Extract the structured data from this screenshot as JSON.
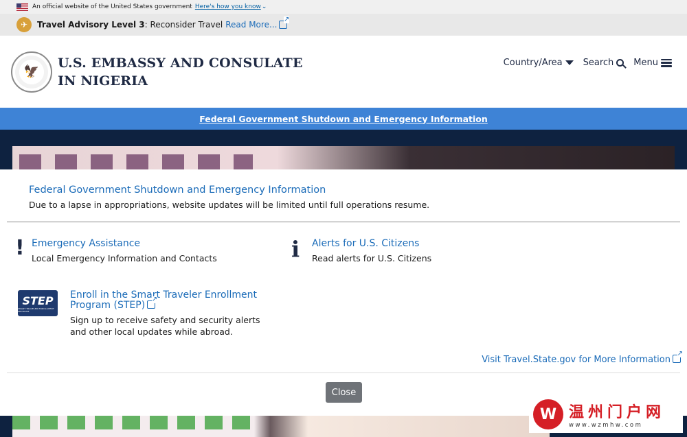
{
  "gov_banner": {
    "text": "An official website of the United States government",
    "link": "Here's how you know"
  },
  "advisory": {
    "label": "Travel Advisory Level 3",
    "separator": ": Reconsider Travel",
    "link": "Read More..."
  },
  "header": {
    "title_line1": "U.S. EMBASSY AND CONSULATE",
    "title_line2": "IN NIGERIA",
    "nav": {
      "country": "Country/Area",
      "search": "Search",
      "menu": "Menu"
    }
  },
  "shutdown_bar": {
    "link": "Federal Government Shutdown and Emergency Information"
  },
  "modal": {
    "title": "Federal Government Shutdown and Emergency Information",
    "subtitle": "Due to a lapse in appropriations, website updates will be limited until full operations resume.",
    "cards": {
      "emergency": {
        "icon": "!",
        "title": "Emergency Assistance",
        "desc": "Local Emergency Information and Contacts"
      },
      "alerts": {
        "icon": "i",
        "title": "Alerts for U.S. Citizens",
        "desc": "Read alerts for U.S. Citizens"
      },
      "step": {
        "logo": "STEP",
        "title_line1": "Enroll in the Smart Traveler Enrollment",
        "title_line2": "Program (STEP)",
        "desc_line1": "Sign up to receive safety and security alerts",
        "desc_line2": "and other local updates while abroad."
      }
    },
    "visit_link": "Visit Travel.State.gov for More Information",
    "close_label": "Close"
  },
  "watermark": {
    "name": "温州门户网",
    "url": "www.wzmhw.com"
  },
  "colors": {
    "link": "#1a6bb8",
    "shutdown_bar": "#3e83d6",
    "navy": "#1f2a44",
    "close_button": "#6f7378"
  }
}
